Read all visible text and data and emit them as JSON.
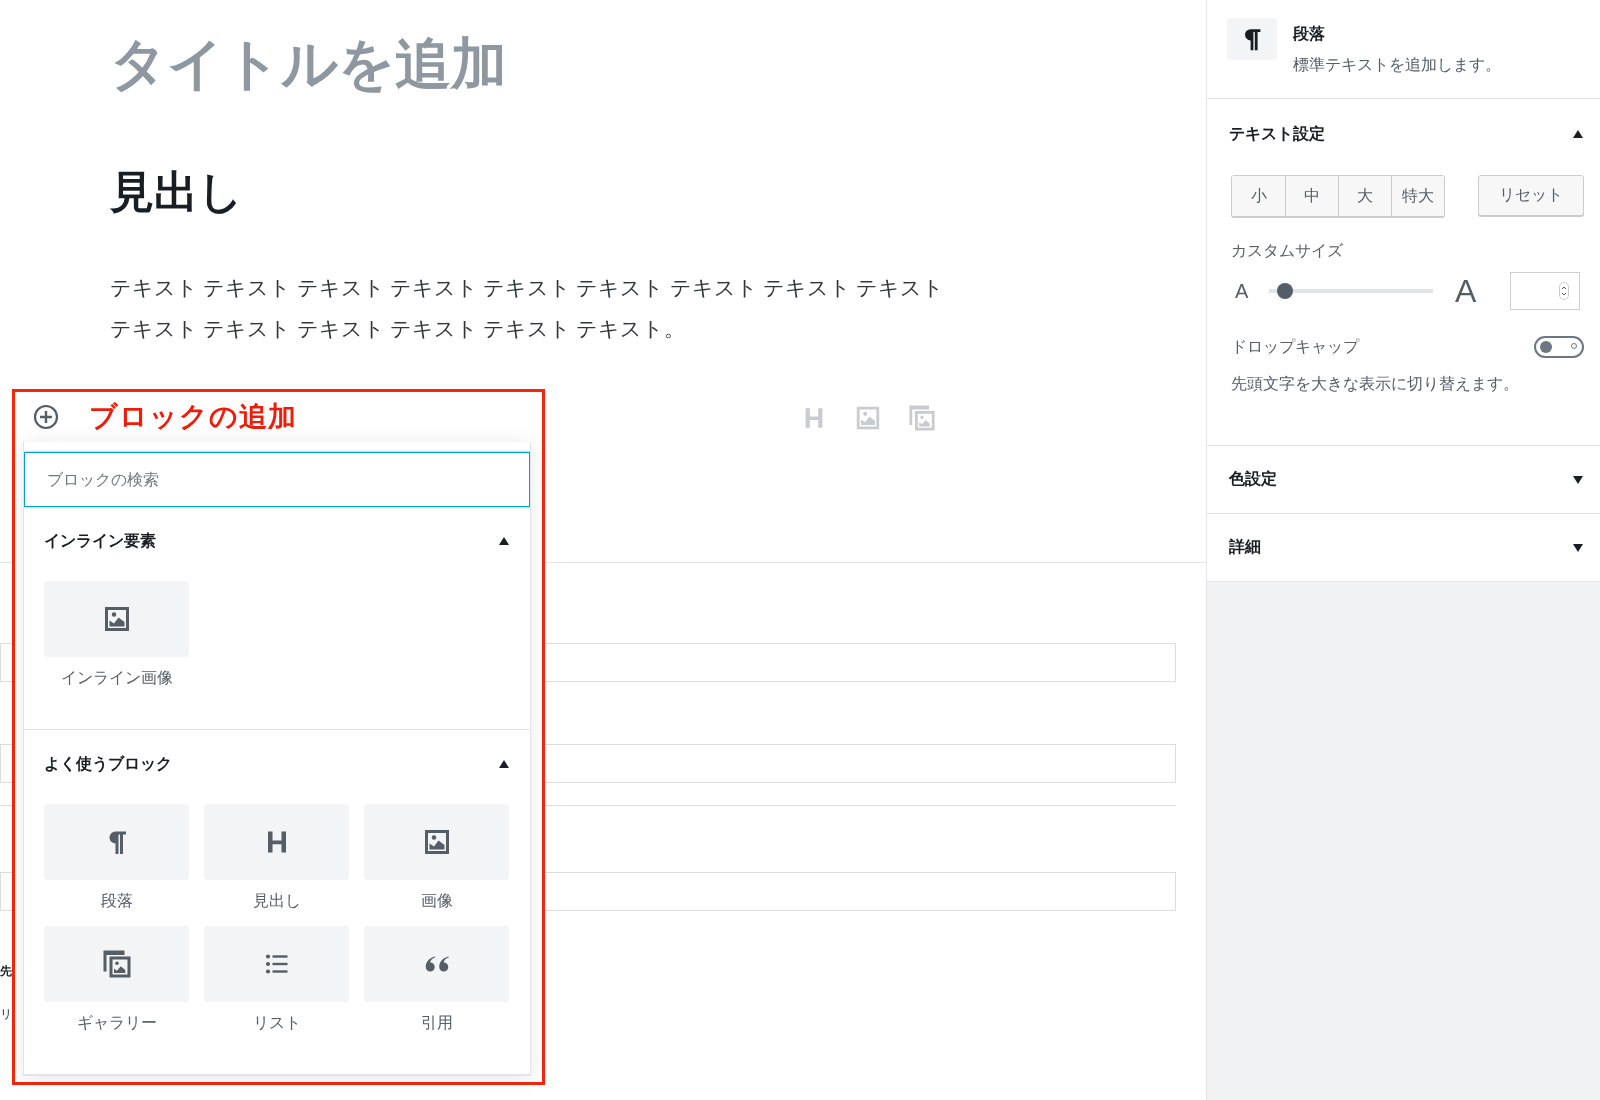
{
  "editor": {
    "title_placeholder": "タイトルを追加",
    "heading": "見出し",
    "paragraph": "テキスト テキスト テキスト テキスト テキスト テキスト テキスト テキスト テキストテキスト テキスト テキスト テキスト テキスト テキスト。",
    "toolbar": [
      {
        "kind": "heading"
      },
      {
        "kind": "image"
      },
      {
        "kind": "gallery"
      }
    ],
    "lower_rows": [
      {
        "kind": "field"
      },
      {
        "kind": "field"
      },
      {
        "kind": "divider"
      },
      {
        "kind": "field"
      }
    ],
    "cut_labels": [
      "先",
      "リ"
    ]
  },
  "inserter": {
    "annotation": "ブロックの追加",
    "search": {
      "placeholder": "ブロックの検索"
    },
    "sections": [
      {
        "title": "インライン要素",
        "expanded": true,
        "items": [
          {
            "kind": "image",
            "label": "インライン画像"
          }
        ]
      },
      {
        "title": "よく使うブロック",
        "expanded": true,
        "items": [
          {
            "kind": "paragraph",
            "label": "段落"
          },
          {
            "kind": "heading",
            "label": "見出し"
          },
          {
            "kind": "image",
            "label": "画像"
          },
          {
            "kind": "gallery",
            "label": "ギャラリー"
          },
          {
            "kind": "list",
            "label": "リスト"
          },
          {
            "kind": "quote",
            "label": "引用"
          }
        ]
      }
    ]
  },
  "sidebar": {
    "block": {
      "kind": "paragraph",
      "name": "段落",
      "description": "標準テキストを追加します。"
    },
    "panels": [
      {
        "kind": "text",
        "title": "テキスト設定",
        "expanded": true,
        "size_buttons": [
          {
            "label": "小",
            "selected": false
          },
          {
            "label": "中",
            "selected": false
          },
          {
            "label": "大",
            "selected": false
          },
          {
            "label": "特大",
            "selected": false
          }
        ],
        "reset": "リセット",
        "custom_size_label": "カスタムサイズ",
        "slider": {
          "small": "A",
          "large": "A",
          "level": 0.1
        },
        "drop_cap": {
          "label": "ドロップキャップ",
          "on": false,
          "help": "先頭文字を大きな表示に切り替えます。"
        }
      },
      {
        "kind": "plain",
        "title": "色設定",
        "expanded": false
      },
      {
        "kind": "plain",
        "title": "詳細",
        "expanded": false
      }
    ]
  }
}
